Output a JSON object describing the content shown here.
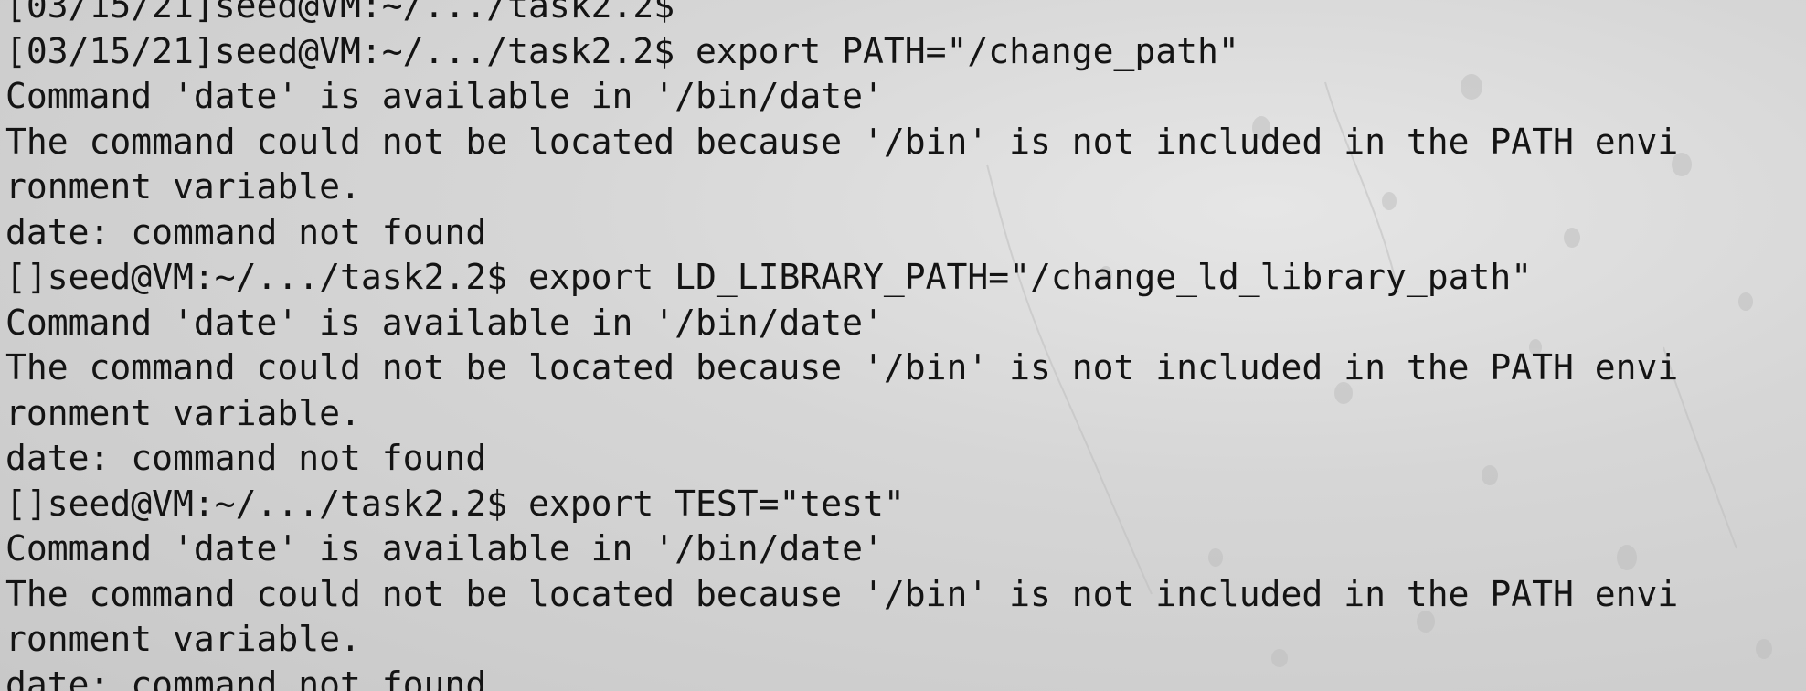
{
  "terminal": {
    "lines": [
      "[03/15/21]seed@VM:~/.../task2.2$",
      "[03/15/21]seed@VM:~/.../task2.2$ export PATH=\"/change_path\"",
      "Command 'date' is available in '/bin/date'",
      "The command could not be located because '/bin' is not included in the PATH envi",
      "ronment variable.",
      "date: command not found",
      "[]seed@VM:~/.../task2.2$ export LD_LIBRARY_PATH=\"/change_ld_library_path\"",
      "Command 'date' is available in '/bin/date'",
      "The command could not be located because '/bin' is not included in the PATH envi",
      "ronment variable.",
      "date: command not found",
      "[]seed@VM:~/.../task2.2$ export TEST=\"test\"",
      "Command 'date' is available in '/bin/date'",
      "The command could not be located because '/bin' is not included in the PATH envi",
      "ronment variable.",
      "date: command not found"
    ]
  }
}
